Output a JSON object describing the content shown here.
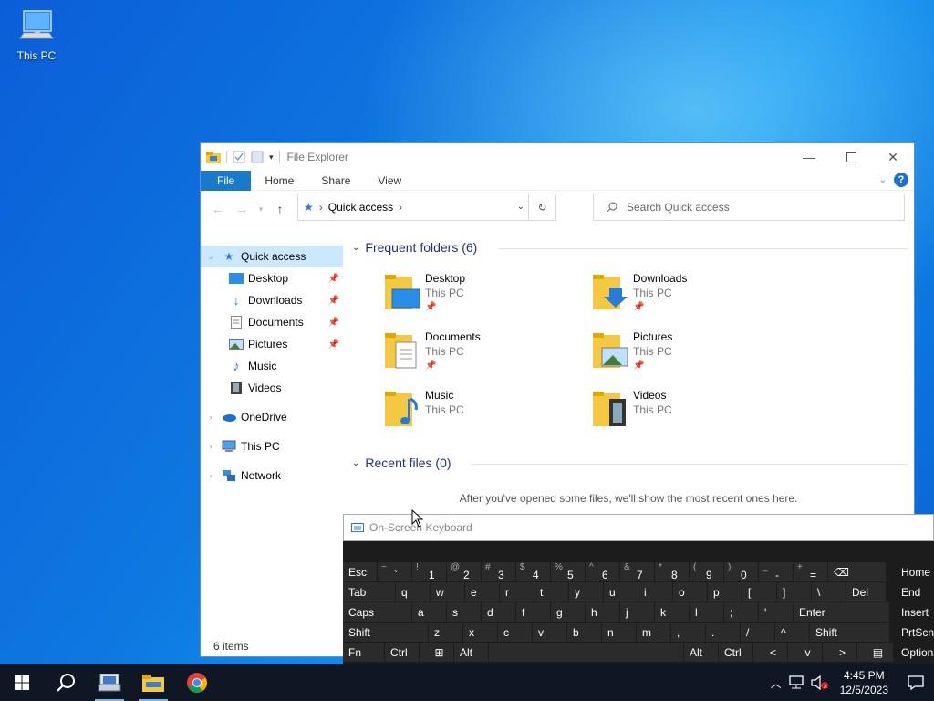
{
  "desktop": {
    "this_pc_label": "This PC"
  },
  "explorer": {
    "title": "File Explorer",
    "tabs": [
      "File",
      "Home",
      "Share",
      "View"
    ],
    "address": {
      "location": "Quick access"
    },
    "search_placeholder": "Search Quick access",
    "nav": {
      "quick_access": "Quick access",
      "pinned": [
        "Desktop",
        "Downloads",
        "Documents",
        "Pictures",
        "Music",
        "Videos"
      ],
      "onedrive": "OneDrive",
      "this_pc": "This PC",
      "network": "Network"
    },
    "frequent_header": "Frequent folders (6)",
    "folders": [
      {
        "name": "Desktop",
        "location": "This PC",
        "pinned": true
      },
      {
        "name": "Downloads",
        "location": "This PC",
        "pinned": true
      },
      {
        "name": "Documents",
        "location": "This PC",
        "pinned": true
      },
      {
        "name": "Pictures",
        "location": "This PC",
        "pinned": true
      },
      {
        "name": "Music",
        "location": "This PC",
        "pinned": false
      },
      {
        "name": "Videos",
        "location": "This PC",
        "pinned": false
      }
    ],
    "recent_header": "Recent files (0)",
    "recent_empty": "After you've opened some files, we'll show the most recent ones here.",
    "status": "6 items"
  },
  "osk": {
    "title": "On-Screen Keyboard",
    "row1": [
      [
        "Esc",
        ""
      ],
      [
        "~",
        "`"
      ],
      [
        "!",
        "1"
      ],
      [
        "@",
        "2"
      ],
      [
        "#",
        "3"
      ],
      [
        "$",
        "4"
      ],
      [
        "%",
        "5"
      ],
      [
        "^",
        "6"
      ],
      [
        "&",
        "7"
      ],
      [
        "*",
        "8"
      ],
      [
        "(",
        "9"
      ],
      [
        ")",
        "0"
      ],
      [
        "_",
        "-"
      ],
      [
        "+",
        "="
      ],
      [
        "⌫",
        ""
      ]
    ],
    "row2": [
      "Tab",
      "q",
      "w",
      "e",
      "r",
      "t",
      "y",
      "u",
      "i",
      "o",
      "p",
      "[",
      "]",
      "\\",
      "Del"
    ],
    "row3": [
      "Caps",
      "a",
      "s",
      "d",
      "f",
      "g",
      "h",
      "j",
      "k",
      "l",
      ";",
      "'",
      "Enter"
    ],
    "row4": [
      "Shift",
      "z",
      "x",
      "c",
      "v",
      "b",
      "n",
      "m",
      ",",
      ".",
      "/",
      "^",
      "Shift"
    ],
    "row5": [
      "Fn",
      "Ctrl",
      "⊞",
      "Alt",
      "",
      "Alt",
      "Ctrl",
      "<",
      "v",
      ">",
      "▤"
    ],
    "navkeys": [
      "Home",
      "End",
      "Insert",
      "PrtScn",
      "Options"
    ]
  },
  "taskbar": {
    "time": "4:45 PM",
    "date": "12/5/2023"
  }
}
